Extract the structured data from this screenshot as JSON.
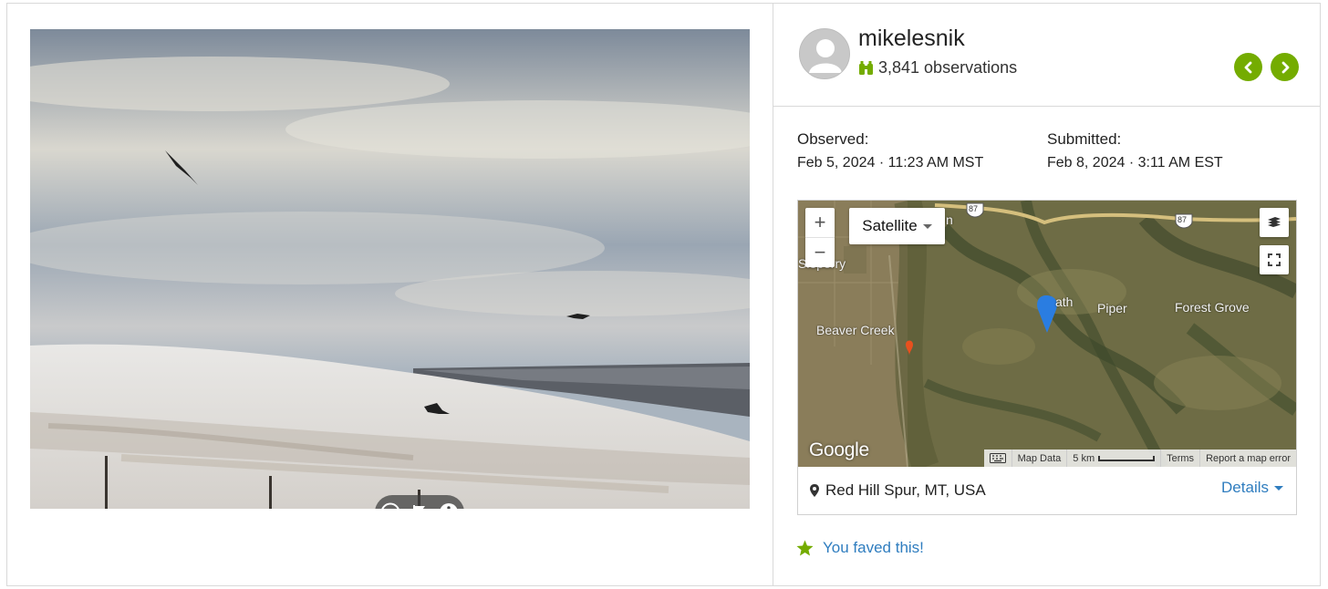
{
  "user": {
    "name": "mikelesnik",
    "observations": "3,841 observations"
  },
  "dates": {
    "observed_label": "Observed:",
    "observed_value": "Feb 5, 2024 · 11:23 AM MST",
    "submitted_label": "Submitted:",
    "submitted_value": "Feb 8, 2024 · 3:11 AM EST"
  },
  "map": {
    "zoom_in": "+",
    "zoom_out": "−",
    "map_type": "Satellite",
    "places": [
      "Beaver Creek",
      "Piper",
      "Forest Grove",
      "ath",
      "Sloperry",
      "n"
    ],
    "highway_shields": [
      "87",
      "87"
    ],
    "logo": "Google",
    "attribution": {
      "map_data": "Map Data",
      "scale": "5 km",
      "terms": "Terms",
      "report": "Report a map error"
    }
  },
  "location": {
    "name": "Red Hill Spur, MT, USA",
    "details_label": "Details"
  },
  "fave": {
    "label": "You faved this!"
  },
  "colors": {
    "accent_green": "#74ac00",
    "link_blue": "#2f7dbf",
    "marker_blue": "#2a7de1"
  },
  "icons": {
    "photo_controls": [
      "creative-commons-icon",
      "flag-icon",
      "info-icon"
    ],
    "nav": [
      "chevron-left-icon",
      "chevron-right-icon"
    ]
  }
}
